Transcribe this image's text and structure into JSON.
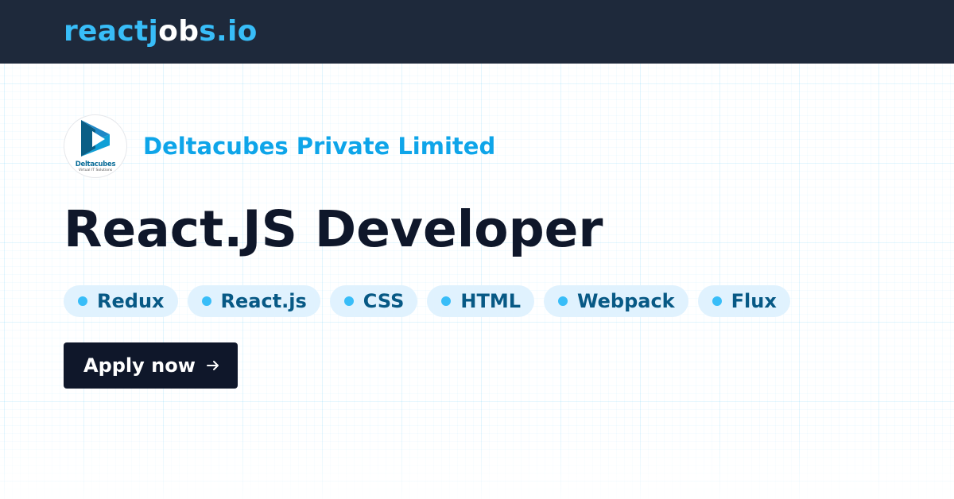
{
  "header": {
    "brand": {
      "part1": "reactj",
      "part2": "ob",
      "part3": "s.io"
    }
  },
  "company": {
    "name": "Deltacubes Private Limited",
    "logo_name": "Deltacubes",
    "logo_tagline": "Virtual IT Solutions"
  },
  "job": {
    "title": "React.JS Developer"
  },
  "tags": [
    {
      "label": "Redux"
    },
    {
      "label": "React.js"
    },
    {
      "label": "CSS"
    },
    {
      "label": "HTML"
    },
    {
      "label": "Webpack"
    },
    {
      "label": "Flux"
    }
  ],
  "apply": {
    "label": "Apply now",
    "icon": "arrow-right-icon"
  },
  "colors": {
    "header_bg": "#1e293b",
    "brand_accent": "#38bdf8",
    "company_name": "#0ea5e9",
    "title": "#0f172a",
    "tag_bg": "#e0f2fe",
    "tag_text": "#075985",
    "button_bg": "#0f172a"
  }
}
